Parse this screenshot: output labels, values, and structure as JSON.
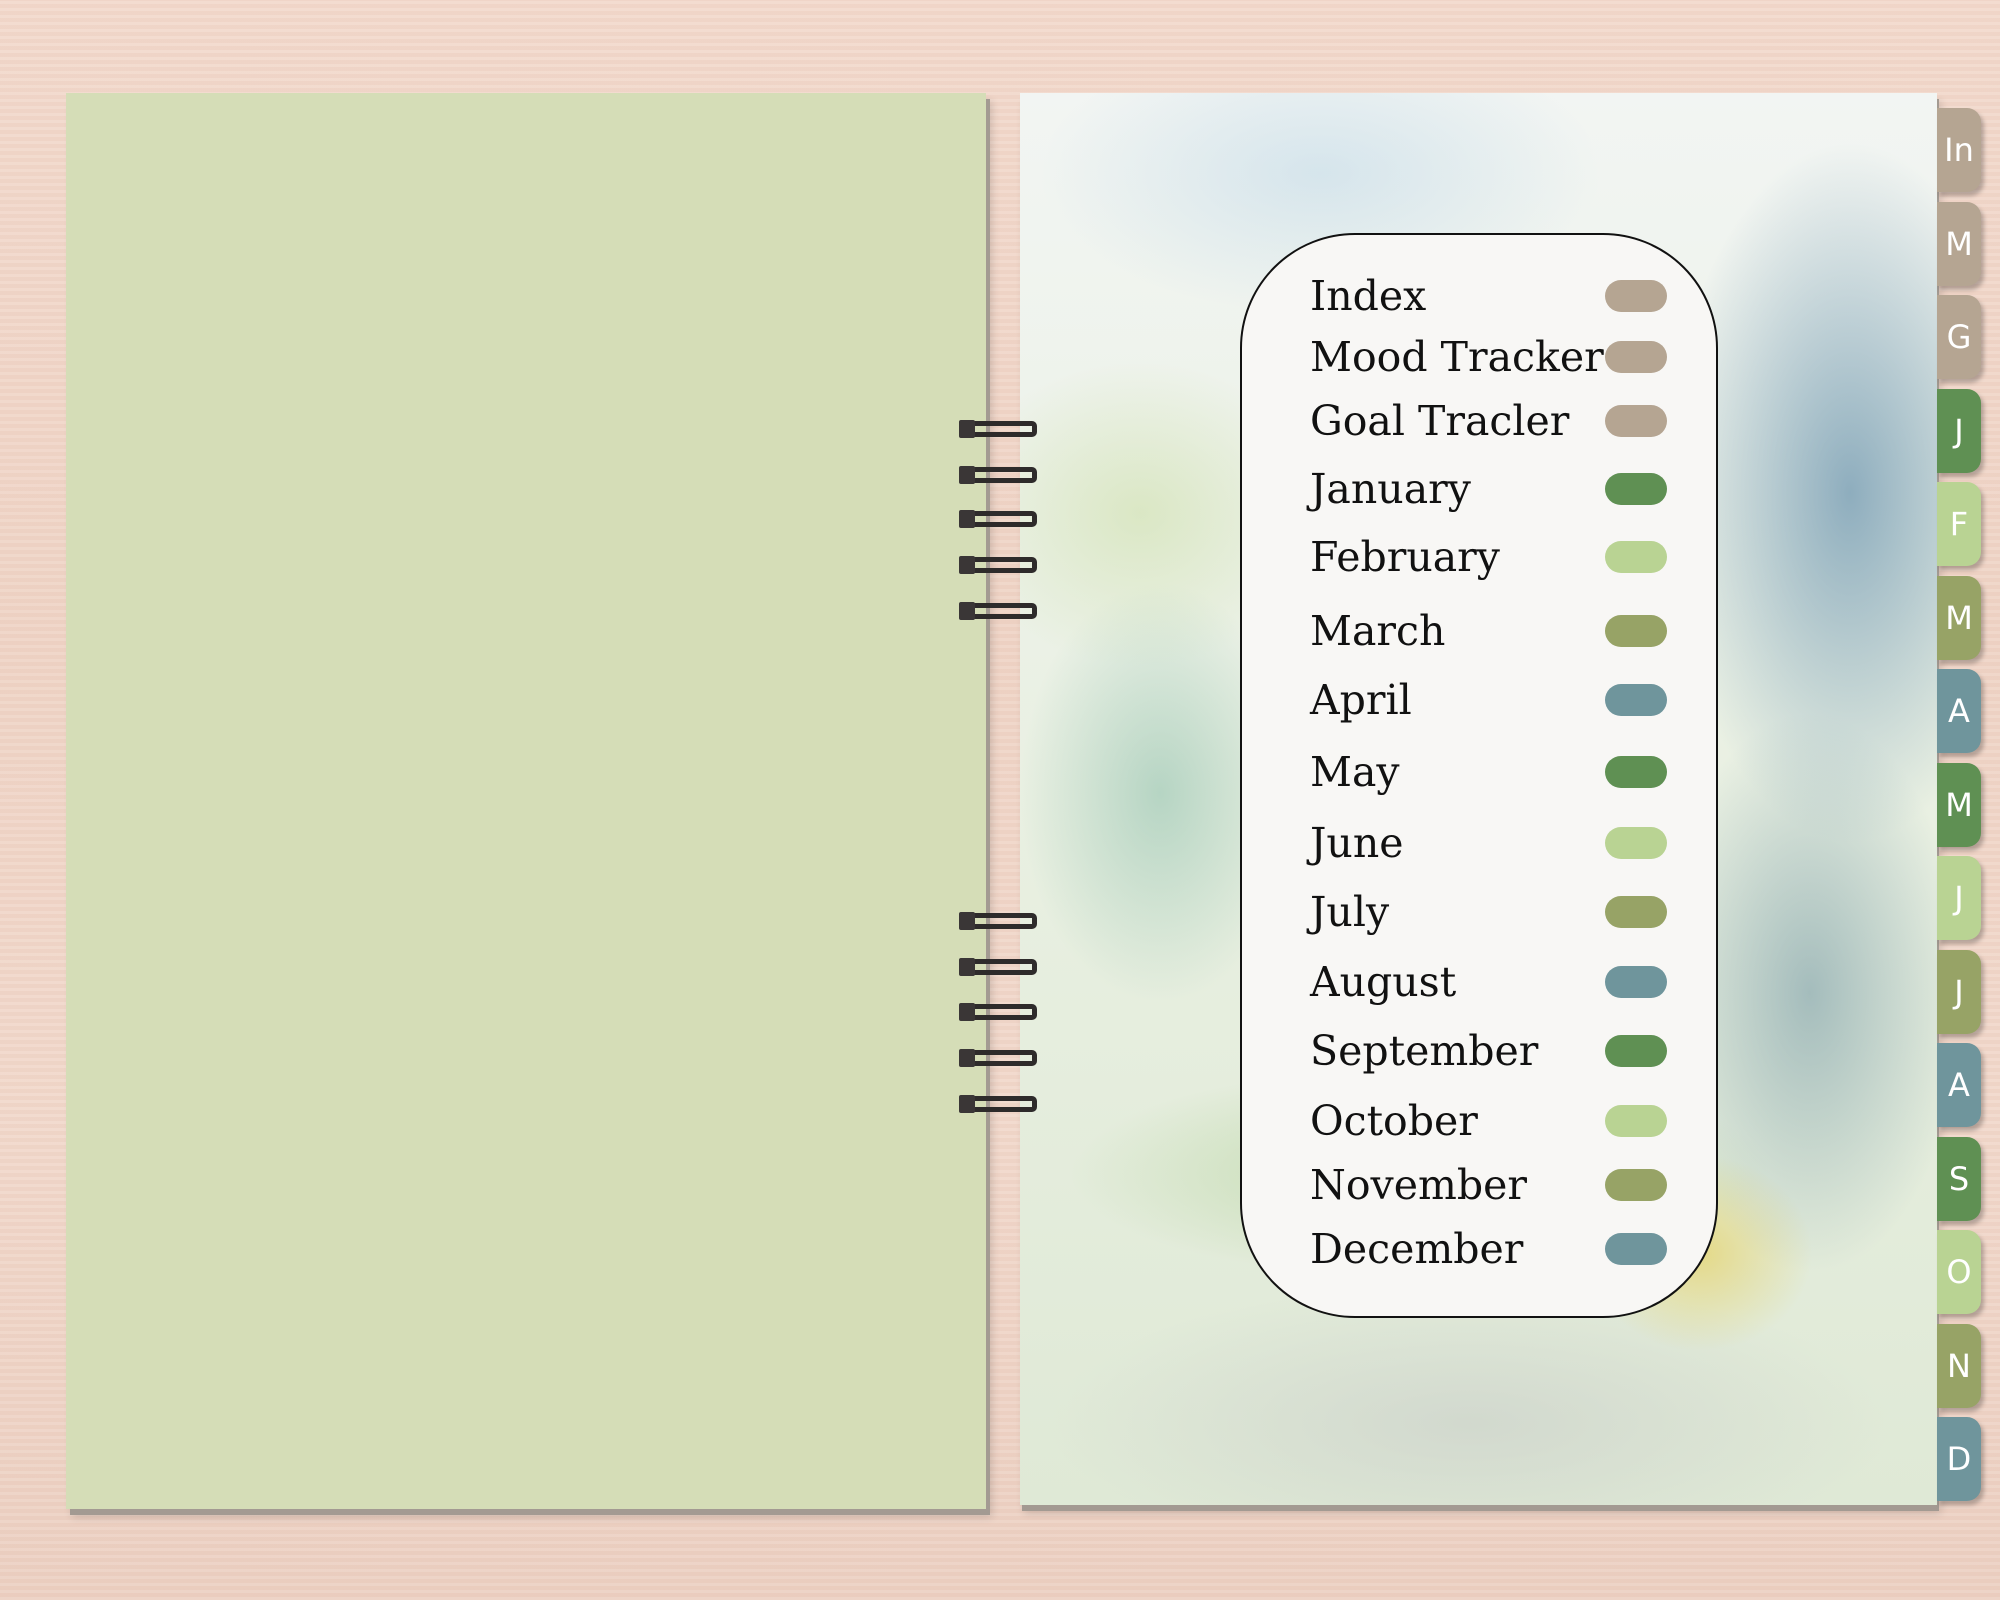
{
  "colors": {
    "neutral": "#b5a592",
    "dark_green": "#5f9053",
    "light_green": "#b9d393",
    "olive": "#97a366",
    "blue": "#6f959c",
    "left_page": "#d5ddb7"
  },
  "index": [
    {
      "label": "Index",
      "tab": "In",
      "color": "#b5a592"
    },
    {
      "label": "Mood Tracker",
      "tab": "M",
      "color": "#b5a592"
    },
    {
      "label": "Goal Tracler",
      "tab": "G",
      "color": "#b5a592"
    },
    {
      "label": "January",
      "tab": "J",
      "color": "#5f9053"
    },
    {
      "label": "February",
      "tab": "F",
      "color": "#b9d393"
    },
    {
      "label": "March",
      "tab": "M",
      "color": "#97a366"
    },
    {
      "label": "April",
      "tab": "A",
      "color": "#6f959c"
    },
    {
      "label": "May",
      "tab": "M",
      "color": "#5f9053"
    },
    {
      "label": "June",
      "tab": "J",
      "color": "#b9d393"
    },
    {
      "label": "July",
      "tab": "J",
      "color": "#97a366"
    },
    {
      "label": "August",
      "tab": "A",
      "color": "#6f959c"
    },
    {
      "label": "September",
      "tab": "S",
      "color": "#5f9053"
    },
    {
      "label": "October",
      "tab": "O",
      "color": "#b9d393"
    },
    {
      "label": "November",
      "tab": "N",
      "color": "#97a366"
    },
    {
      "label": "December",
      "tab": "D",
      "color": "#6f959c"
    }
  ]
}
